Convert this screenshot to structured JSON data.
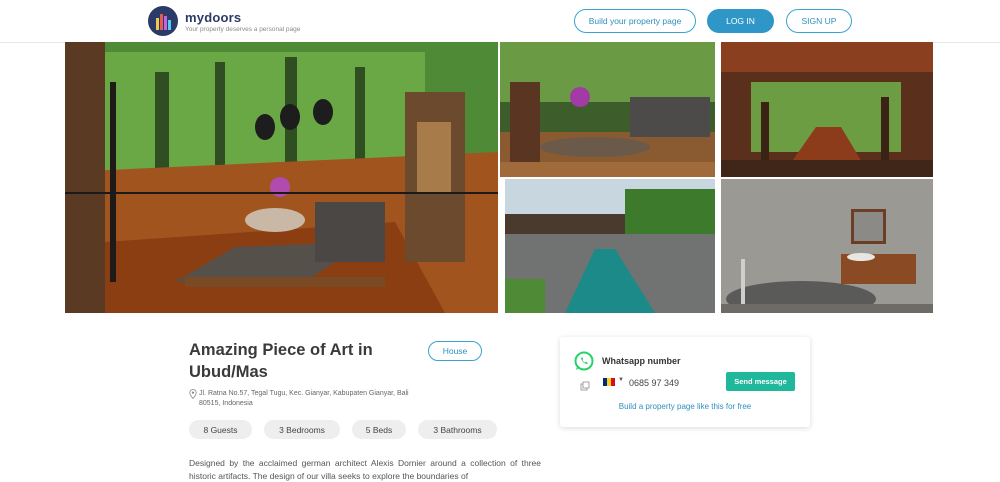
{
  "header": {
    "brand_name": "mydoors",
    "brand_tagline": "Your property deserves a personal page",
    "build_button": "Build your property page",
    "login_button": "LOG IN",
    "signup_button": "SIGN UP"
  },
  "listing": {
    "title": "Amazing Piece of Art in Ubud/Mas",
    "type_badge": "House",
    "address": "Jl. Ratna No.57, Tegal Tugu, Kec. Gianyar, Kabupaten Gianyar, Bali 80515, Indonesia",
    "features": [
      "8 Guests",
      "3 Bedrooms",
      "5 Beds",
      "3 Bathrooms"
    ],
    "description": "Designed by the acclaimed german architect Alexis Dornier around a collection of three historic artifacts. The design of our villa seeks to explore the boundaries of"
  },
  "contact": {
    "label": "Whatsapp number",
    "phone": "0685 97 349",
    "send_button": "Send message",
    "build_link": "Build a property page like this for free"
  },
  "colors": {
    "accent": "#2f97c7",
    "brand": "#2b3a67",
    "whatsapp": "#25d366",
    "send": "#1fb89a"
  }
}
